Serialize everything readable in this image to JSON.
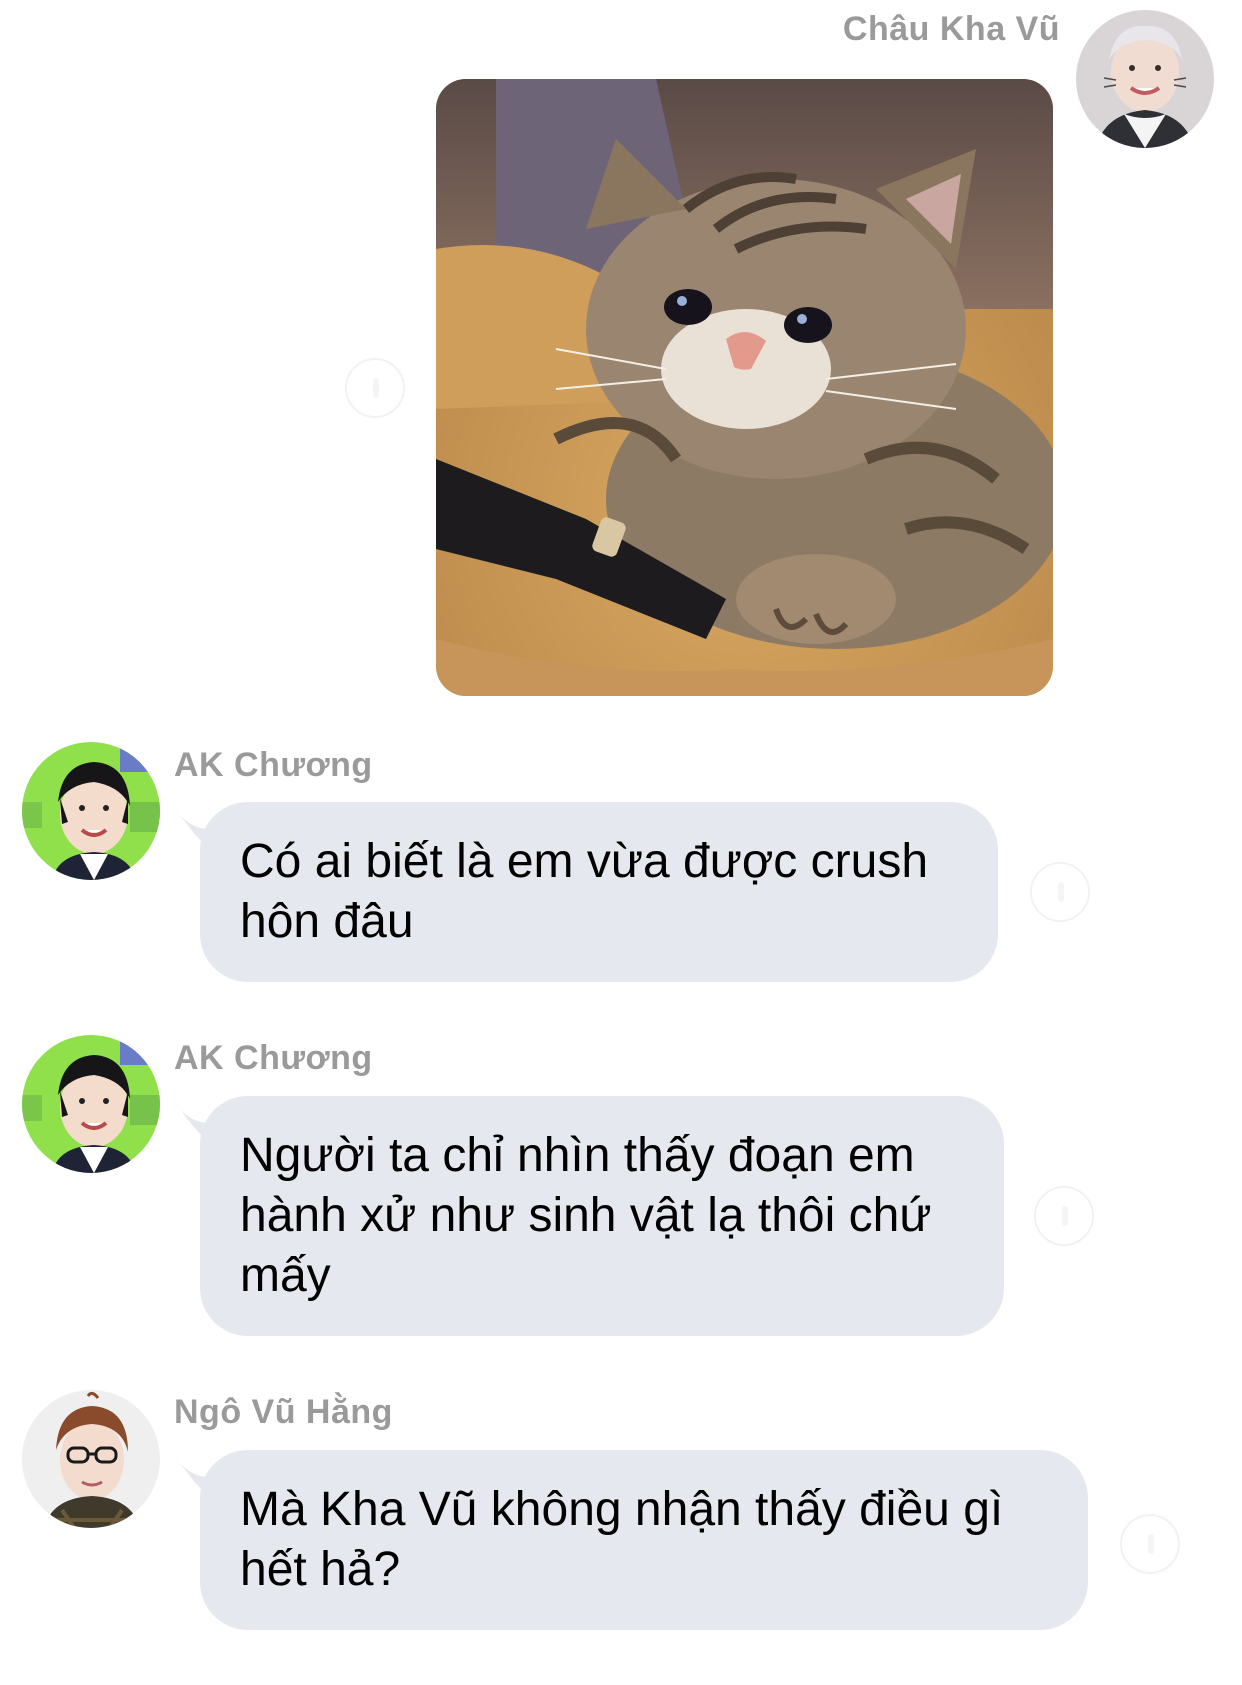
{
  "messages": [
    {
      "id": "m1",
      "sender": "Châu Kha Vũ",
      "direction": "outgoing",
      "type": "sticker",
      "sticker_icon": "crying-cat-sticker"
    },
    {
      "id": "m2",
      "sender": "AK Chương",
      "direction": "incoming",
      "type": "text",
      "text": "Có ai biết là em vừa được crush\nhôn đâu"
    },
    {
      "id": "m3",
      "sender": "AK Chương",
      "direction": "incoming",
      "type": "text",
      "text": "Người ta chỉ nhìn thấy đoạn em\nhành xử như sinh vật lạ thôi chứ\nmấy"
    },
    {
      "id": "m4",
      "sender": "Ngô Vũ Hằng",
      "direction": "incoming",
      "type": "text",
      "text": "Mà Kha Vũ không nhận thấy điều gì\nhết hả?"
    }
  ],
  "colors": {
    "bubble_incoming": "#e5e8ee",
    "sender_name": "#9a9a9a",
    "background": "#ffffff",
    "avatar_green": "#8fe04a"
  }
}
